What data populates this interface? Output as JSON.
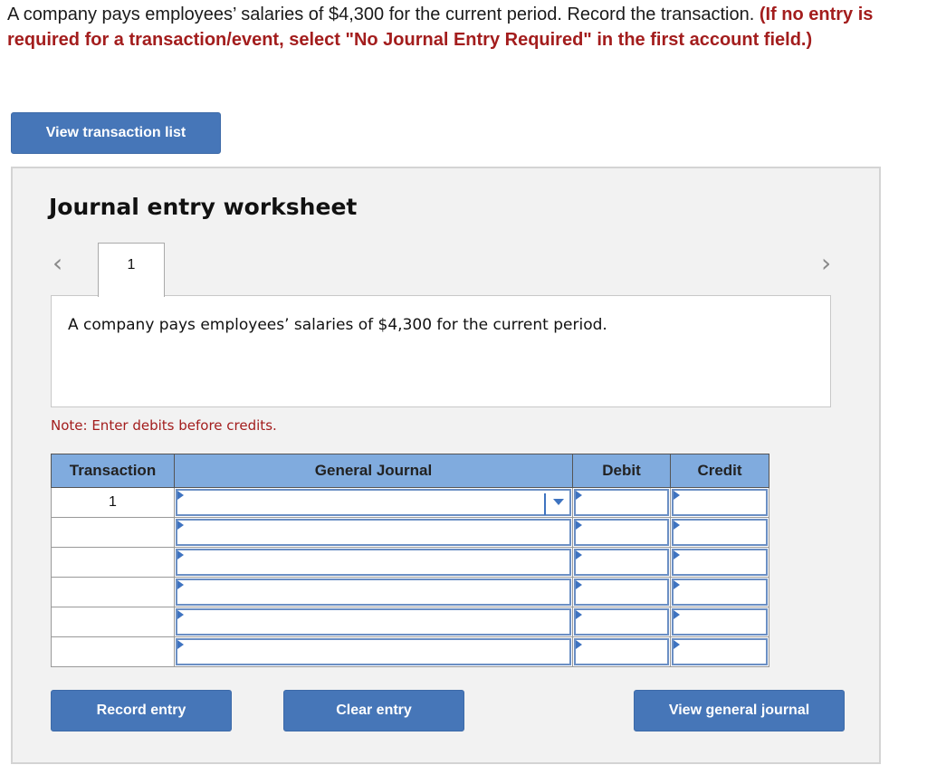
{
  "question": {
    "text": "A company pays employees’ salaries of $4,300 for the current period. Record the transaction. ",
    "instruction": "(If no entry is required for a transaction/event, select \"No Journal Entry Required\" in the first account field.)"
  },
  "buttons": {
    "view_transaction_list": "View transaction list",
    "record_entry": "Record entry",
    "clear_entry": "Clear entry",
    "view_general_journal": "View general journal"
  },
  "worksheet": {
    "title": "Journal entry worksheet",
    "prev_icon": "‹",
    "next_icon": "›",
    "tabs": [
      {
        "label": "1"
      }
    ],
    "description": "A company pays employees’ salaries of $4,300 for the current period.",
    "note": "Note: Enter debits before credits."
  },
  "table": {
    "headers": {
      "transaction": "Transaction",
      "general_journal": "General Journal",
      "debit": "Debit",
      "credit": "Credit"
    },
    "rows": [
      {
        "transaction": "1",
        "account": "",
        "debit": "",
        "credit": ""
      },
      {
        "transaction": "",
        "account": "",
        "debit": "",
        "credit": ""
      },
      {
        "transaction": "",
        "account": "",
        "debit": "",
        "credit": ""
      },
      {
        "transaction": "",
        "account": "",
        "debit": "",
        "credit": ""
      },
      {
        "transaction": "",
        "account": "",
        "debit": "",
        "credit": ""
      },
      {
        "transaction": "",
        "account": "",
        "debit": "",
        "credit": ""
      }
    ]
  },
  "colors": {
    "button_blue": "#4676b8",
    "header_blue": "#80abde",
    "instruction_red": "#a31d1d",
    "panel_bg": "#f2f2f2"
  }
}
